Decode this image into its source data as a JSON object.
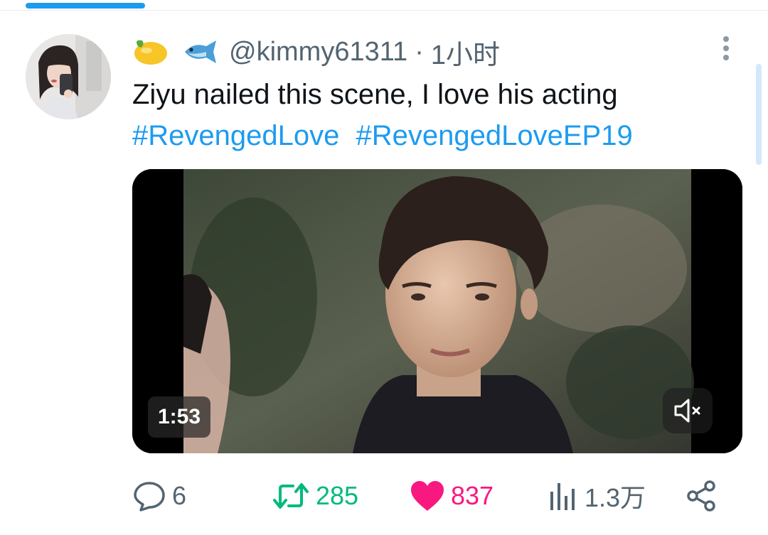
{
  "header": {
    "handle": "@kimmy61311",
    "separator": "·",
    "time": "1小时",
    "emoji_icons": [
      "lemon-emoji",
      "fish-emoji"
    ],
    "more_icon": "vertical-ellipsis-icon"
  },
  "tweet": {
    "text": "Ziyu nailed this scene, I love his acting",
    "hashtags": [
      "#RevengedLove",
      "#RevengedLoveEP19"
    ]
  },
  "video": {
    "duration": "1:53",
    "mute_icon": "speaker-muted-icon"
  },
  "actions": {
    "replies": "6",
    "retweets": "285",
    "likes": "837",
    "views": "1.3万"
  },
  "colors": {
    "accent": "#1d9bf0",
    "text": "#0f1419",
    "muted": "#536471",
    "retweet": "#00ba7c",
    "like": "#f91880"
  }
}
